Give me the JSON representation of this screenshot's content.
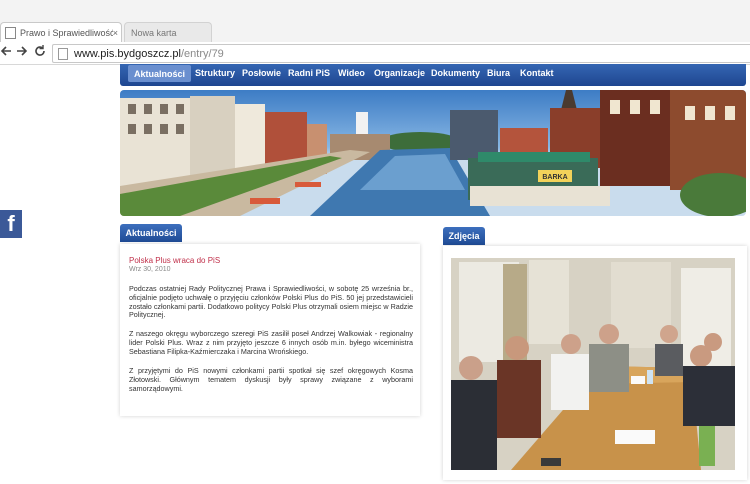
{
  "browser": {
    "tabs": [
      {
        "title": "Prawo i Sprawiedliwość -",
        "close": "×"
      },
      {
        "title": "Nowa karta"
      }
    ],
    "url_host": "www.pis.bydgoszcz.pl",
    "url_path": "/entry/79",
    "icons": {
      "back": "back-arrow",
      "forward": "forward-arrow",
      "reload": "reload"
    }
  },
  "menu": {
    "items": [
      "Aktualności",
      "Struktury",
      "Posłowie",
      "Radni PiS",
      "Wideo",
      "Organizacje",
      "Dokumenty",
      "Biura",
      "Kontakt"
    ],
    "active_index": 0
  },
  "banner": {
    "sign": "BARKA"
  },
  "social": {
    "facebook": "f"
  },
  "news": {
    "section_label": "Aktualności",
    "article_title": "Polska Plus wraca do PiS",
    "date": "Wrz 30, 2010",
    "paragraphs": [
      "Podczas ostatniej Rady Politycznej Prawa i Sprawiedliwości, w sobotę 25 września br., oficjalnie podjęto uchwałę o przyjęciu członków Polski Plus do PiS. 50 jej przedstawicieli zostało członkami partii. Dodatkowo politycy Polski Plus otrzymali osiem miejsc w Radzie Politycznej.",
      "Z naszego okręgu wyborczego szeregi PiS zasilił poseł Andrzej Walkowiak - regionalny lider Polski Plus. Wraz z nim przyjęto jeszcze 6 innych osób m.in. byłego wiceministra Sebastiana Filipka-Kaźmierczaka i Marcina Wrońskiego.",
      "Z przyjętymi do PiS nowymi członkami partii spotkał się szef okręgowych Kosma Złotowski. Głównym tematem dyskusji były sprawy związane z wyborami samorządowymi."
    ]
  },
  "photos": {
    "section_label": "Zdjęcia"
  },
  "colors": {
    "menu": "#1e4690",
    "accent": "#3d6fbd",
    "title": "#c0304a",
    "facebook": "#3b5998"
  }
}
